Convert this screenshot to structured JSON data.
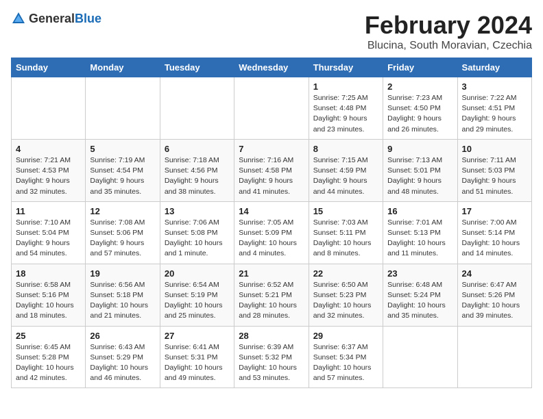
{
  "logo": {
    "general": "General",
    "blue": "Blue"
  },
  "title": "February 2024",
  "subtitle": "Blucina, South Moravian, Czechia",
  "days_header": [
    "Sunday",
    "Monday",
    "Tuesday",
    "Wednesday",
    "Thursday",
    "Friday",
    "Saturday"
  ],
  "weeks": [
    [
      {
        "day": "",
        "detail": ""
      },
      {
        "day": "",
        "detail": ""
      },
      {
        "day": "",
        "detail": ""
      },
      {
        "day": "",
        "detail": ""
      },
      {
        "day": "1",
        "detail": "Sunrise: 7:25 AM\nSunset: 4:48 PM\nDaylight: 9 hours\nand 23 minutes."
      },
      {
        "day": "2",
        "detail": "Sunrise: 7:23 AM\nSunset: 4:50 PM\nDaylight: 9 hours\nand 26 minutes."
      },
      {
        "day": "3",
        "detail": "Sunrise: 7:22 AM\nSunset: 4:51 PM\nDaylight: 9 hours\nand 29 minutes."
      }
    ],
    [
      {
        "day": "4",
        "detail": "Sunrise: 7:21 AM\nSunset: 4:53 PM\nDaylight: 9 hours\nand 32 minutes."
      },
      {
        "day": "5",
        "detail": "Sunrise: 7:19 AM\nSunset: 4:54 PM\nDaylight: 9 hours\nand 35 minutes."
      },
      {
        "day": "6",
        "detail": "Sunrise: 7:18 AM\nSunset: 4:56 PM\nDaylight: 9 hours\nand 38 minutes."
      },
      {
        "day": "7",
        "detail": "Sunrise: 7:16 AM\nSunset: 4:58 PM\nDaylight: 9 hours\nand 41 minutes."
      },
      {
        "day": "8",
        "detail": "Sunrise: 7:15 AM\nSunset: 4:59 PM\nDaylight: 9 hours\nand 44 minutes."
      },
      {
        "day": "9",
        "detail": "Sunrise: 7:13 AM\nSunset: 5:01 PM\nDaylight: 9 hours\nand 48 minutes."
      },
      {
        "day": "10",
        "detail": "Sunrise: 7:11 AM\nSunset: 5:03 PM\nDaylight: 9 hours\nand 51 minutes."
      }
    ],
    [
      {
        "day": "11",
        "detail": "Sunrise: 7:10 AM\nSunset: 5:04 PM\nDaylight: 9 hours\nand 54 minutes."
      },
      {
        "day": "12",
        "detail": "Sunrise: 7:08 AM\nSunset: 5:06 PM\nDaylight: 9 hours\nand 57 minutes."
      },
      {
        "day": "13",
        "detail": "Sunrise: 7:06 AM\nSunset: 5:08 PM\nDaylight: 10 hours\nand 1 minute."
      },
      {
        "day": "14",
        "detail": "Sunrise: 7:05 AM\nSunset: 5:09 PM\nDaylight: 10 hours\nand 4 minutes."
      },
      {
        "day": "15",
        "detail": "Sunrise: 7:03 AM\nSunset: 5:11 PM\nDaylight: 10 hours\nand 8 minutes."
      },
      {
        "day": "16",
        "detail": "Sunrise: 7:01 AM\nSunset: 5:13 PM\nDaylight: 10 hours\nand 11 minutes."
      },
      {
        "day": "17",
        "detail": "Sunrise: 7:00 AM\nSunset: 5:14 PM\nDaylight: 10 hours\nand 14 minutes."
      }
    ],
    [
      {
        "day": "18",
        "detail": "Sunrise: 6:58 AM\nSunset: 5:16 PM\nDaylight: 10 hours\nand 18 minutes."
      },
      {
        "day": "19",
        "detail": "Sunrise: 6:56 AM\nSunset: 5:18 PM\nDaylight: 10 hours\nand 21 minutes."
      },
      {
        "day": "20",
        "detail": "Sunrise: 6:54 AM\nSunset: 5:19 PM\nDaylight: 10 hours\nand 25 minutes."
      },
      {
        "day": "21",
        "detail": "Sunrise: 6:52 AM\nSunset: 5:21 PM\nDaylight: 10 hours\nand 28 minutes."
      },
      {
        "day": "22",
        "detail": "Sunrise: 6:50 AM\nSunset: 5:23 PM\nDaylight: 10 hours\nand 32 minutes."
      },
      {
        "day": "23",
        "detail": "Sunrise: 6:48 AM\nSunset: 5:24 PM\nDaylight: 10 hours\nand 35 minutes."
      },
      {
        "day": "24",
        "detail": "Sunrise: 6:47 AM\nSunset: 5:26 PM\nDaylight: 10 hours\nand 39 minutes."
      }
    ],
    [
      {
        "day": "25",
        "detail": "Sunrise: 6:45 AM\nSunset: 5:28 PM\nDaylight: 10 hours\nand 42 minutes."
      },
      {
        "day": "26",
        "detail": "Sunrise: 6:43 AM\nSunset: 5:29 PM\nDaylight: 10 hours\nand 46 minutes."
      },
      {
        "day": "27",
        "detail": "Sunrise: 6:41 AM\nSunset: 5:31 PM\nDaylight: 10 hours\nand 49 minutes."
      },
      {
        "day": "28",
        "detail": "Sunrise: 6:39 AM\nSunset: 5:32 PM\nDaylight: 10 hours\nand 53 minutes."
      },
      {
        "day": "29",
        "detail": "Sunrise: 6:37 AM\nSunset: 5:34 PM\nDaylight: 10 hours\nand 57 minutes."
      },
      {
        "day": "",
        "detail": ""
      },
      {
        "day": "",
        "detail": ""
      }
    ]
  ]
}
